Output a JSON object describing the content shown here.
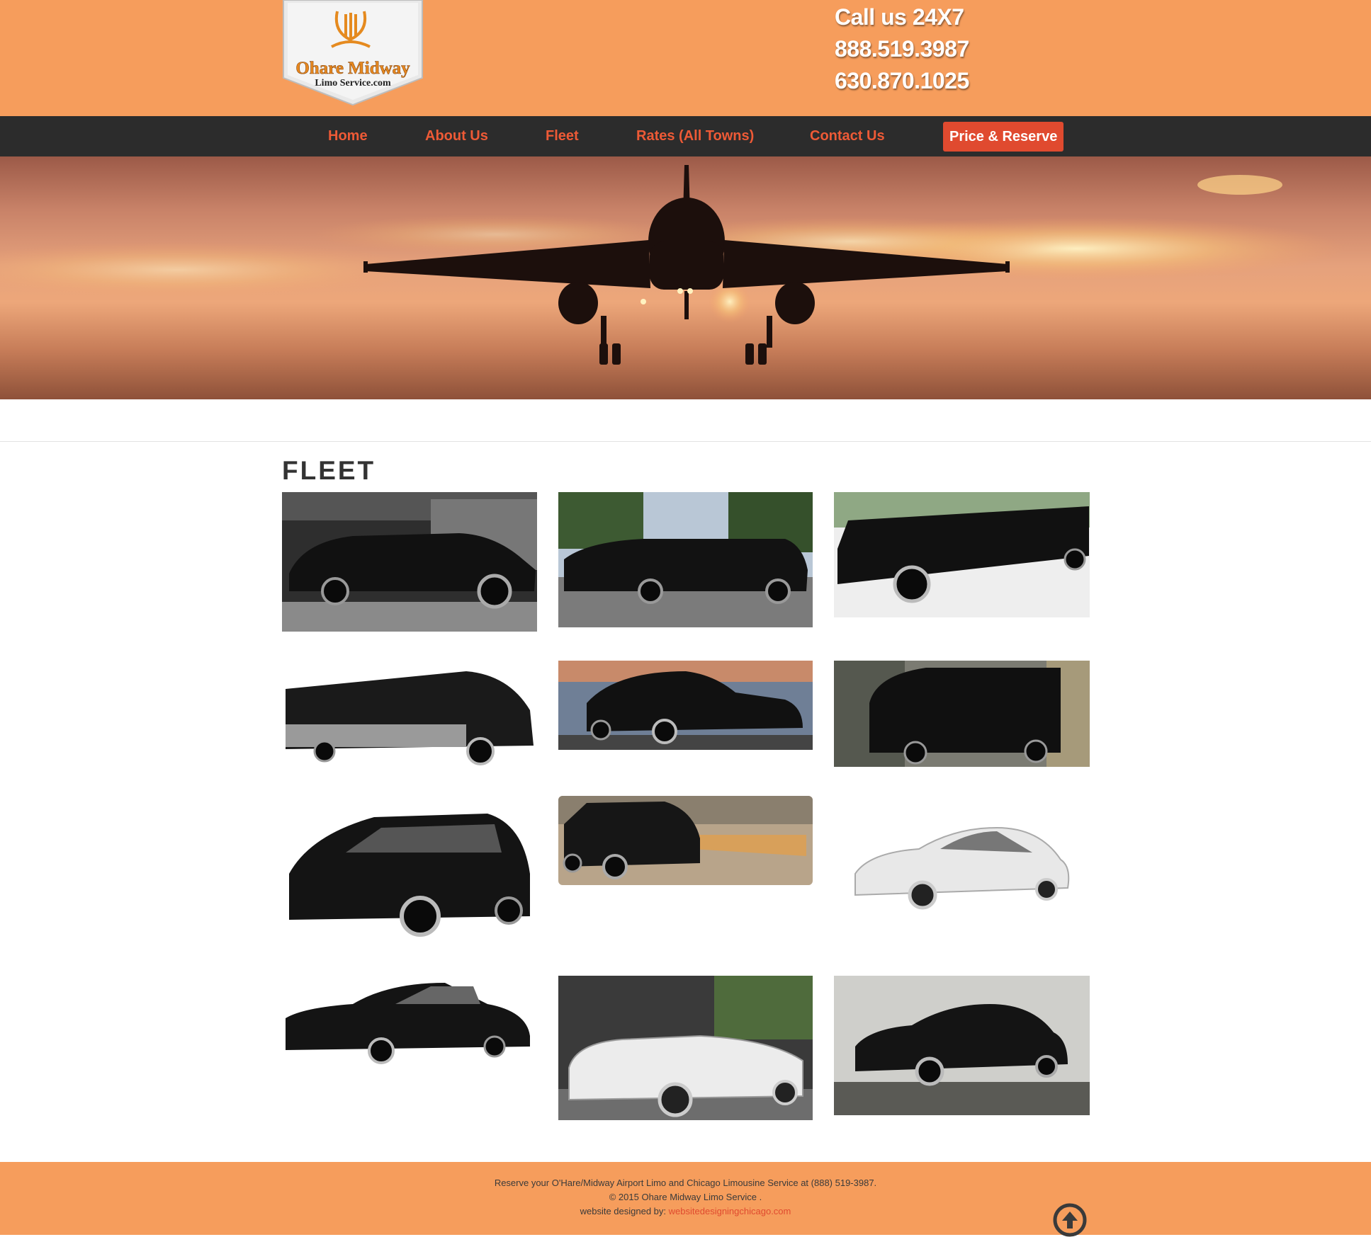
{
  "header": {
    "logo_text_line1": "Ohare Midway",
    "logo_text_line2": "Limo Service.com",
    "call_label": "Call us 24X7",
    "phone1": "888.519.3987",
    "phone2": "630.870.1025"
  },
  "nav": {
    "items": [
      "Home",
      "About Us",
      "Fleet",
      "Rates (All Towns)",
      "Contact Us"
    ],
    "cta": "Price & Reserve"
  },
  "colors": {
    "brand_orange": "#f69d5c",
    "nav_bg": "#2c2c2c",
    "accent_red": "#e04a2f"
  },
  "fleet": {
    "title": "FLEET",
    "vehicles": [
      {
        "icon": "black-stretch-limousine-garage-image"
      },
      {
        "icon": "black-stretch-limousine-trees-image"
      },
      {
        "icon": "black-hummer-stretch-limousine-image"
      },
      {
        "icon": "black-party-bus-image"
      },
      {
        "icon": "black-lincoln-sedan-waterfront-image"
      },
      {
        "icon": "black-sprinter-van-image"
      },
      {
        "icon": "black-minivan-image"
      },
      {
        "icon": "black-escalade-suv-jet-image"
      },
      {
        "icon": "white-mercedes-sedan-image"
      },
      {
        "icon": "black-lincoln-town-car-image"
      },
      {
        "icon": "white-rolls-royce-convertible-image"
      },
      {
        "icon": "black-mercedes-sedan-image"
      }
    ]
  },
  "footer": {
    "line1": "Reserve your O'Hare/Midway Airport Limo and Chicago Limousine Service at (888) 519-3987.",
    "line2": "© 2015 Ohare Midway Limo Service .",
    "line3_prefix": "website designed by:",
    "line3_link": "websitedesigningchicago.com"
  }
}
